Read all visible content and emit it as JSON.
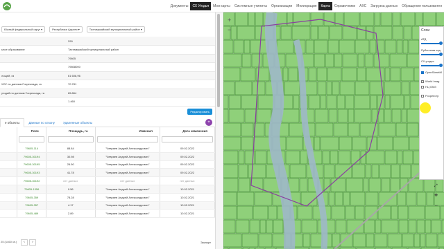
{
  "nav": [
    "Документы",
    "СХ Угодья",
    "Мои карты",
    "Системные утилиты",
    "Организации",
    "Мелиорация",
    "Карта",
    "Справочники",
    "АХС",
    "Загрузка данных",
    "Обращения пользовател"
  ],
  "filters": [
    "Южный федеральный округ ▾",
    "Республика Адыгея ▾",
    "Тахтамукайский муниципальный район ▾"
  ],
  "properties": [
    {
      "label": "",
      "value": "299"
    },
    {
      "label": "ьное образование",
      "value": "Тахтамукайский муниципальный район"
    },
    {
      "label": "",
      "value": "79605"
    },
    {
      "label": "",
      "value": "79608000"
    },
    {
      "label": "лощей, га",
      "value": "61 608,96"
    },
    {
      "label": "ХОУ по данным Госреклада, га",
      "value": "70.781"
    },
    {
      "label": "угодий по данным Госреклада, га",
      "value": "65.864"
    },
    {
      "label": "",
      "value": "1.460"
    }
  ],
  "edit_button": "Редактировать",
  "tabs": [
    "е объекты",
    "Данные по сезону",
    "Удаленные объекты"
  ],
  "columns": [
    "Поле",
    "Площадь, га",
    "Изменил",
    "Дата изменения"
  ],
  "rows": [
    [
      "79605-114",
      "88.84",
      "\"Чевряев Андрей Александрович\"",
      "09.02.2022"
    ],
    [
      "79605-30194",
      "30.98",
      "\"Чевряев Андрей Александрович\"",
      "09.02.2022"
    ],
    [
      "79605-30195",
      "26.50",
      "\"Чевряев Андрей Александрович\"",
      "09.02.2022"
    ],
    [
      "79605-30193",
      "41.78",
      "\"Чевряев Андрей Александрович\"",
      "09.02.2022"
    ],
    [
      "79605-30192",
      "нет данных",
      "нет данных",
      "нет данных"
    ],
    [
      "79605-1356",
      "9.56",
      "\"Чевряев Андрей Александрович\"",
      "10.02.2021"
    ],
    [
      "79605-359",
      "78.28",
      "\"Чевряев Андрей Александрович\"",
      "10.02.2021"
    ],
    [
      "79605-357",
      "4.17",
      "\"Чевряев Андрей Александрович\"",
      "10.02.2021"
    ],
    [
      "79605-489",
      "2.89",
      "\"Чевряев Андрей Александрович\"",
      "10.02.2021"
    ]
  ],
  "pager": "25 (1460 зп.)",
  "export_label": "Экспорт",
  "layers": {
    "title": "Слои",
    "items": [
      "АТД",
      "Публичная кад",
      "СХ угодья",
      "OpenStreetM",
      "World Imag",
      "НЦ ОМЗ",
      "Росреестр"
    ],
    "checked": [
      false,
      false,
      false,
      true,
      false,
      false,
      false
    ]
  },
  "colors": {
    "field_fill": "#8fd07a",
    "field_stroke": "#3c8a2e",
    "river": "#9fb8c8",
    "boundary": "#8a3fa0",
    "accent": "#1a8fd8"
  }
}
